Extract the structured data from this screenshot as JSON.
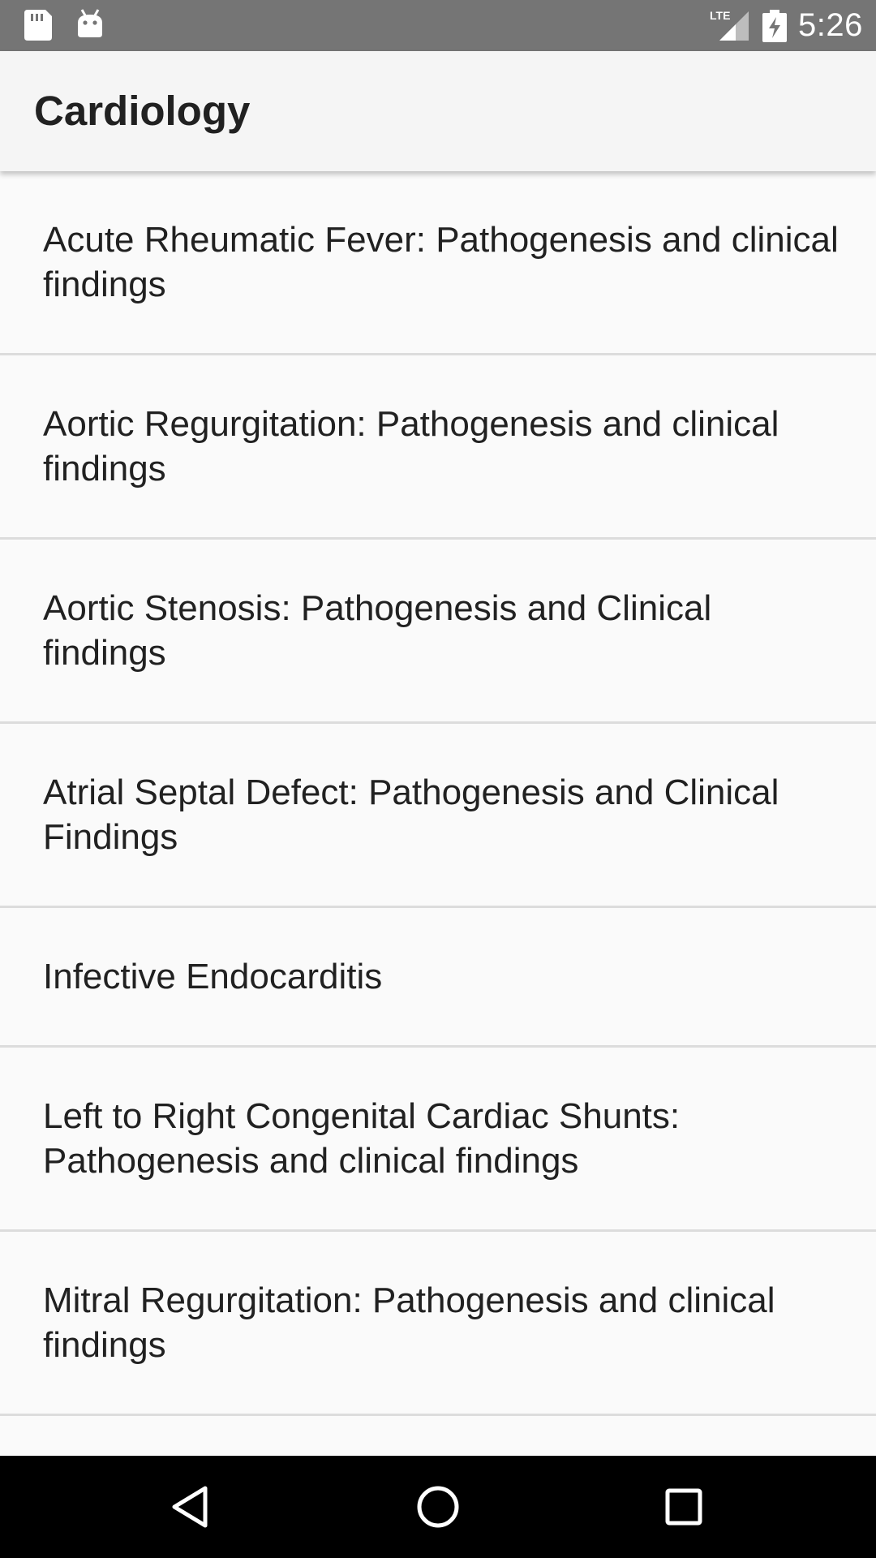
{
  "status_bar": {
    "time": "5:26",
    "network_label": "LTE",
    "icons": [
      "sd-card-icon",
      "android-icon",
      "lte-signal-icon",
      "battery-charging-icon"
    ]
  },
  "app_bar": {
    "title": "Cardiology"
  },
  "topics": [
    {
      "label": "Acute Rheumatic Fever: Pathogenesis and clinical findings"
    },
    {
      "label": "Aortic Regurgitation: Pathogenesis and clinical findings"
    },
    {
      "label": "Aortic Stenosis: Pathogenesis and Clinical findings"
    },
    {
      "label": "Atrial Septal Defect: Pathogenesis and Clinical Findings"
    },
    {
      "label": "Infective Endocarditis"
    },
    {
      "label": "Left to Right Congenital Cardiac Shunts: Pathogenesis and clinical findings"
    },
    {
      "label": "Mitral Regurgitation: Pathogenesis and clinical findings"
    }
  ],
  "nav_bar": {
    "icons": [
      "back-triangle-icon",
      "home-circle-icon",
      "recents-square-icon"
    ]
  },
  "colors": {
    "status_bar": "#757575",
    "app_bar": "#f5f5f5",
    "background": "#fafafa",
    "divider": "#dcdcdc",
    "text": "#212121",
    "nav_bar": "#000000"
  }
}
